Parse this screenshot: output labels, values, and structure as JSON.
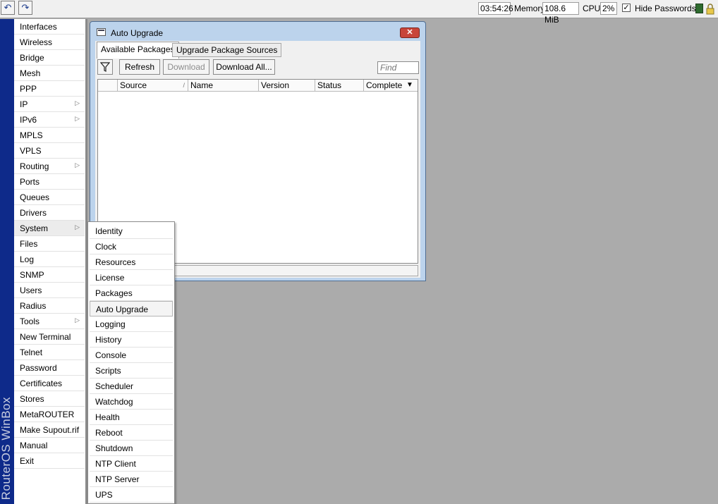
{
  "toolbar": {
    "undo_icon": "undo-icon",
    "redo_icon": "redo-icon",
    "time": "03:54:26",
    "memory_label": "Memory:",
    "memory_value": "108.6 MiB",
    "cpu_label": "CPU:",
    "cpu_value": "2%",
    "hide_passwords_label": "Hide Passwords",
    "hide_passwords_checked": true
  },
  "brand": {
    "vertical_text": "RouterOS WinBox"
  },
  "sidebar": {
    "items": [
      {
        "label": "Interfaces"
      },
      {
        "label": "Wireless"
      },
      {
        "label": "Bridge"
      },
      {
        "label": "Mesh"
      },
      {
        "label": "PPP"
      },
      {
        "label": "IP",
        "has_submenu": true
      },
      {
        "label": "IPv6",
        "has_submenu": true
      },
      {
        "label": "MPLS"
      },
      {
        "label": "VPLS"
      },
      {
        "label": "Routing",
        "has_submenu": true
      },
      {
        "label": "Ports"
      },
      {
        "label": "Queues"
      },
      {
        "label": "Drivers"
      },
      {
        "label": "System",
        "has_submenu": true,
        "active": true
      },
      {
        "label": "Files"
      },
      {
        "label": "Log"
      },
      {
        "label": "SNMP"
      },
      {
        "label": "Users"
      },
      {
        "label": "Radius"
      },
      {
        "label": "Tools",
        "has_submenu": true
      },
      {
        "label": "New Terminal"
      },
      {
        "label": "Telnet"
      },
      {
        "label": "Password"
      },
      {
        "label": "Certificates"
      },
      {
        "label": "Stores"
      },
      {
        "label": "MetaROUTER"
      },
      {
        "label": "Make Supout.rif"
      },
      {
        "label": "Manual"
      },
      {
        "label": "Exit"
      }
    ]
  },
  "system_submenu": {
    "items": [
      {
        "label": "Identity"
      },
      {
        "label": "Clock"
      },
      {
        "label": "Resources"
      },
      {
        "label": "License"
      },
      {
        "label": "Packages"
      },
      {
        "label": "Auto Upgrade",
        "highlighted": true
      },
      {
        "label": "Logging"
      },
      {
        "label": "History"
      },
      {
        "label": "Console"
      },
      {
        "label": "Scripts"
      },
      {
        "label": "Scheduler"
      },
      {
        "label": "Watchdog"
      },
      {
        "label": "Health"
      },
      {
        "label": "Reboot"
      },
      {
        "label": "Shutdown"
      },
      {
        "label": "NTP Client"
      },
      {
        "label": "NTP Server"
      },
      {
        "label": "UPS"
      }
    ]
  },
  "window": {
    "title": "Auto Upgrade",
    "close_label": "✕",
    "tabs": [
      {
        "label": "Available Packages",
        "active": true
      },
      {
        "label": "Upgrade Package Sources",
        "active": false
      }
    ],
    "buttons": {
      "refresh": "Refresh",
      "download": "Download",
      "download_all": "Download All..."
    },
    "find_placeholder": "Find",
    "columns": [
      "Source",
      "Name",
      "Version",
      "Status",
      "Completed"
    ],
    "rows": []
  },
  "colors": {
    "desktop": "#ababab",
    "brand_band": "#0e2a8a",
    "window_frame": "#bcd3ec",
    "close_button": "#c8453a"
  }
}
